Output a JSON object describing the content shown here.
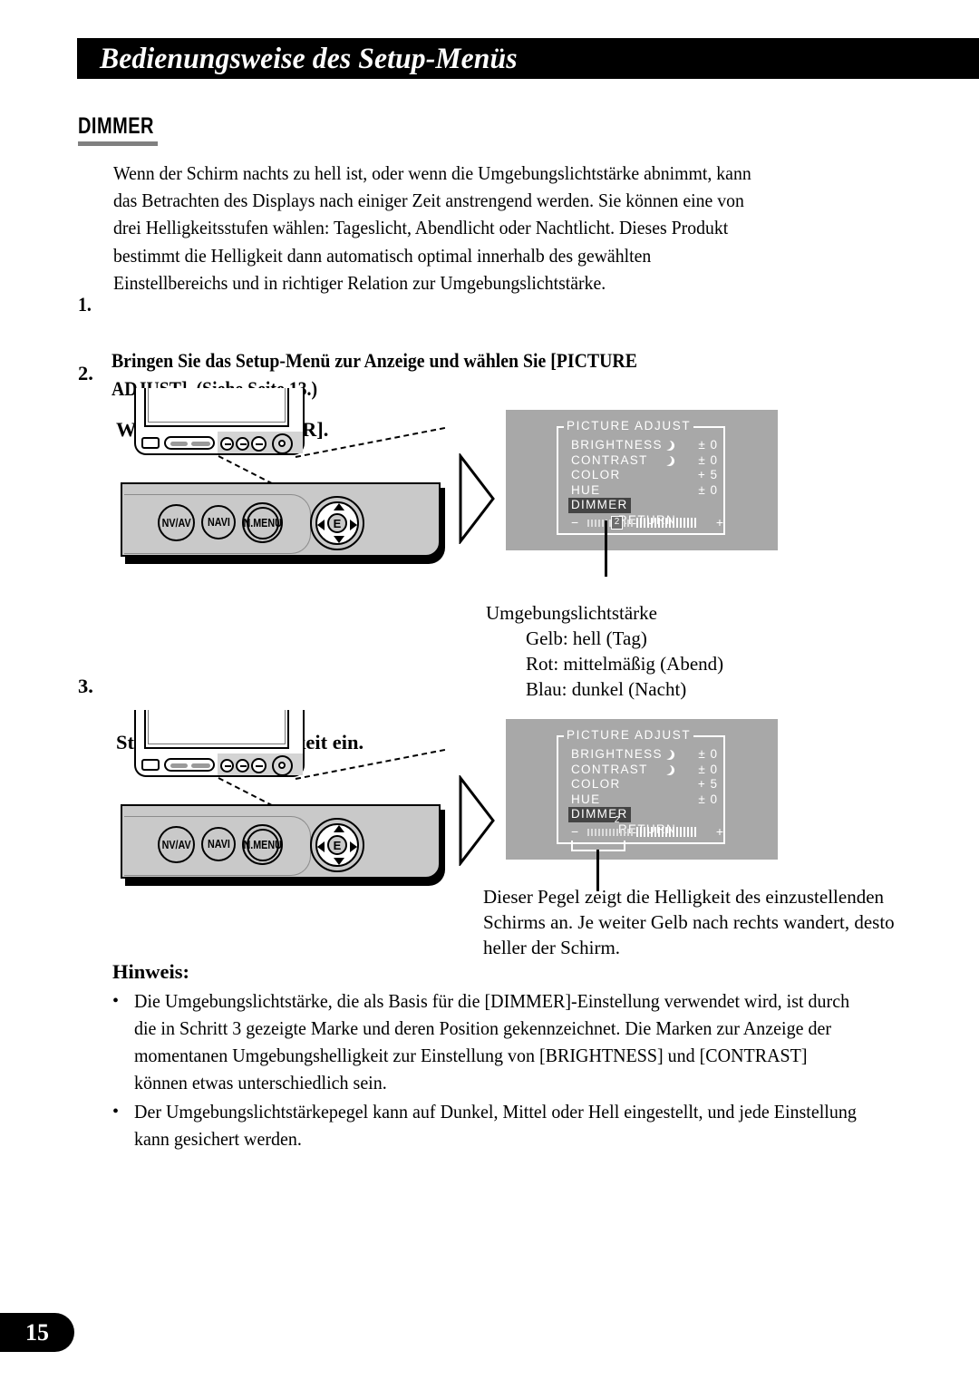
{
  "header": {
    "title": "Bedienungsweise des Setup-Menüs"
  },
  "section": {
    "title": "DIMMER",
    "intro": "Wenn der Schirm nachts zu hell ist, oder wenn die Umgebungslichtstärke abnimmt, kann\ndas Betrachten des Displays nach einiger Zeit anstrengend werden. Sie können eine von\ndrei Helligkeitsstufen wählen: Tageslicht, Abendlicht oder Nachtlicht. Dieses Produkt\nbestimmt die Helligkeit dann automatisch optimal innerhalb des gewählten\nEinstellbereichs und in richtiger Relation zur Umgebungslichtstärke."
  },
  "steps": [
    {
      "number": "1.",
      "text": "Bringen Sie das Setup-Menü zur Anzeige und wählen Sie [PICTURE\nADJUST]. (Siehe Seite 13.)"
    },
    {
      "number": "2.",
      "text": "Wählen Sie [DIMMER]."
    },
    {
      "number": "3.",
      "text": "Stellen Sie die Helligkeit ein."
    }
  ],
  "device": {
    "buttons": [
      {
        "label": "NV/AV"
      },
      {
        "label": "NAVI"
      },
      {
        "label": "N.MENU"
      }
    ],
    "dpad_center_label": "E"
  },
  "osd": {
    "title": "PICTURE ADJUST",
    "rows": [
      {
        "label": "BRIGHTNESS",
        "value": "± 0",
        "moon": true,
        "highlight": false
      },
      {
        "label": "CONTRAST",
        "value": "± 0",
        "moon": true,
        "highlight": false
      },
      {
        "label": "COLOR",
        "value": "+ 5",
        "moon": false,
        "highlight": false
      },
      {
        "label": "HUE",
        "value": "± 0",
        "moon": false,
        "highlight": false
      },
      {
        "label": "DIMMER",
        "value": "",
        "moon": false,
        "highlight": true
      },
      {
        "label": "RETURN",
        "value": "",
        "moon": false,
        "highlight": false,
        "center": true
      }
    ],
    "bar": {
      "minus": "−",
      "plus": "+",
      "marker_label": "2"
    }
  },
  "captions": {
    "ambient_title": "Umgebungslichtstärke",
    "ambient_lines": "Gelb: hell (Tag)\nRot: mittelmäßig (Abend)\nBlau: dunkel (Nacht)",
    "level_note": "Dieser Pegel zeigt die Helligkeit des einzustellenden\nSchirms an. Je weiter Gelb nach rechts wandert, desto\nheller der Schirm."
  },
  "note": {
    "title": "Hinweis:",
    "bullet_char": "•",
    "items": [
      "Die Umgebungslichtstärke, die als Basis für die [DIMMER]-Einstellung verwendet wird, ist durch\ndie in Schritt 3 gezeigte Marke und deren Position gekennzeichnet. Die Marken zur Anzeige der\nmomentanen Umgebungshelligkeit zur Einstellung von [BRIGHTNESS] und [CONTRAST]\nkönnen etwas unterschiedlich sein.",
      "Der Umgebungslichtstärkepegel kann auf Dunkel, Mittel oder Hell eingestellt, und jede Einstellung\nkann gesichert werden."
    ]
  },
  "footer": {
    "page_number": "15"
  },
  "colors": {
    "banner": "#000000",
    "rule": "#808080",
    "osd_bg": "#a8a8a8",
    "panel_face": "#c9c9c9",
    "highlight": "#444444"
  }
}
